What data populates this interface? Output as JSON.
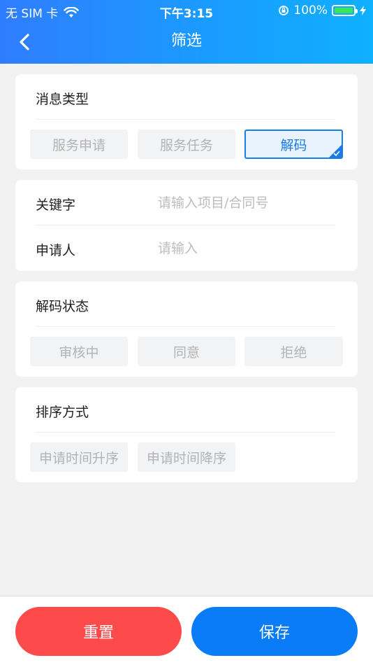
{
  "status_bar": {
    "carrier": "无 SIM 卡",
    "time": "下午3:15",
    "battery": "100%",
    "battery_level": 1.0
  },
  "nav": {
    "title": "筛选",
    "back_icon": "chevron-left-icon"
  },
  "message_type": {
    "title": "消息类型",
    "options": [
      {
        "label": "服务申请",
        "selected": false
      },
      {
        "label": "服务任务",
        "selected": false
      },
      {
        "label": "解码",
        "selected": true
      }
    ]
  },
  "keyword": {
    "label": "关键字",
    "placeholder": "请输入项目/合同号",
    "value": ""
  },
  "applicant": {
    "label": "申请人",
    "placeholder": "请输入",
    "value": ""
  },
  "decode_status": {
    "title": "解码状态",
    "options": [
      {
        "label": "审核中",
        "selected": false
      },
      {
        "label": "同意",
        "selected": false
      },
      {
        "label": "拒绝",
        "selected": false
      }
    ]
  },
  "sort": {
    "title": "排序方式",
    "options": [
      {
        "label": "申请时间升序",
        "selected": false
      },
      {
        "label": "申请时间降序",
        "selected": false
      }
    ]
  },
  "actions": {
    "reset_label": "重置",
    "save_label": "保存"
  },
  "colors": {
    "accent": "#1a7ce8",
    "reset": "#fd4a4a",
    "save": "#0a7cf7"
  }
}
